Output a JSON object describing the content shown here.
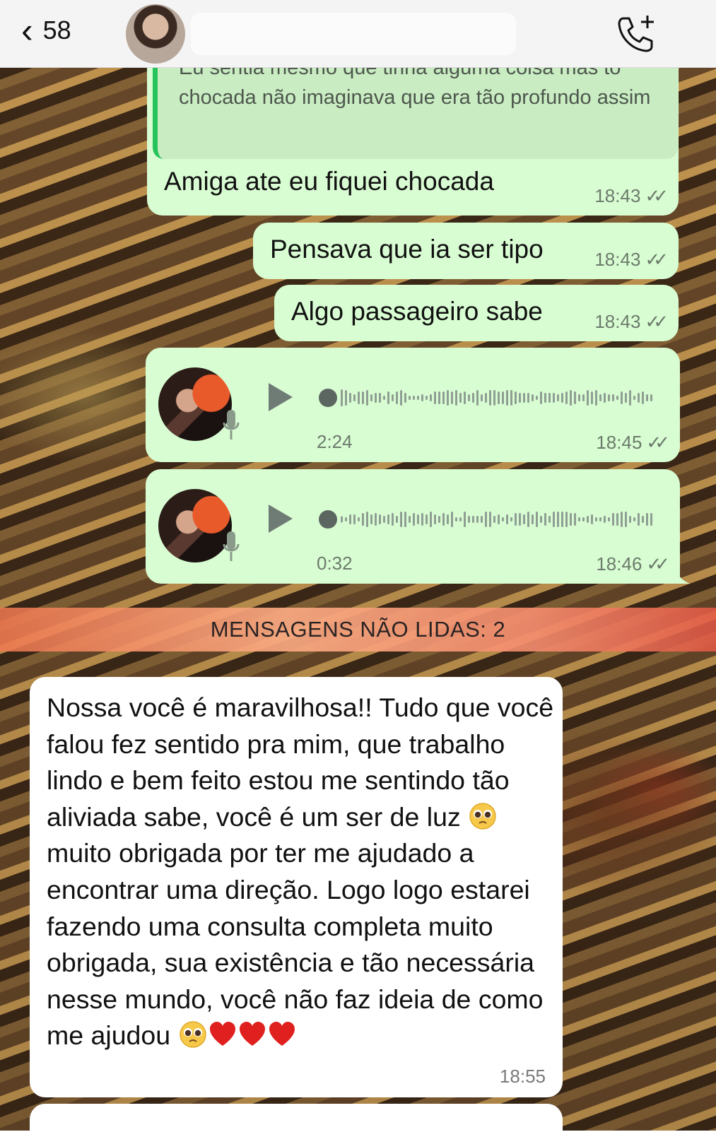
{
  "header": {
    "back_count": "58",
    "icons": {
      "back": "chevron-left-icon",
      "call": "add-call-icon"
    }
  },
  "messages": {
    "quoted": {
      "quote_text": "Eu sentia mesmo que tinha alguma coisa mas tô chocada não imaginava que era tão profundo assim",
      "text": "Amiga ate eu fiquei chocada",
      "time": "18:43"
    },
    "m2": {
      "text": "Pensava que ia ser tipo",
      "time": "18:43"
    },
    "m3": {
      "text": "Algo passageiro sabe",
      "time": "18:43"
    },
    "voice1": {
      "duration": "2:24",
      "time": "18:45"
    },
    "voice2": {
      "duration": "0:32",
      "time": "18:46"
    }
  },
  "unread_banner": "MENSAGENS NÃO LIDAS: 2",
  "incoming": {
    "parts": {
      "p1": "Nossa você é maravilhosa!! Tudo que você falou fez sentido pra mim, que trabalho lindo e bem feito estou me sentindo tão aliviada sabe, você é um ser de luz ",
      "p2": " muito obrigada por ter me ajudado a encontrar uma direção. Logo logo estarei fazendo uma consulta completa muito obrigada, sua existência e tão necessária nesse mundo, você não faz ideia de como me ajudou "
    },
    "time": "18:55"
  },
  "colors": {
    "outgoing": "#d9fdd3",
    "incoming": "#ffffff",
    "header": "#f4f4f4",
    "banner": "#f5a07f"
  }
}
